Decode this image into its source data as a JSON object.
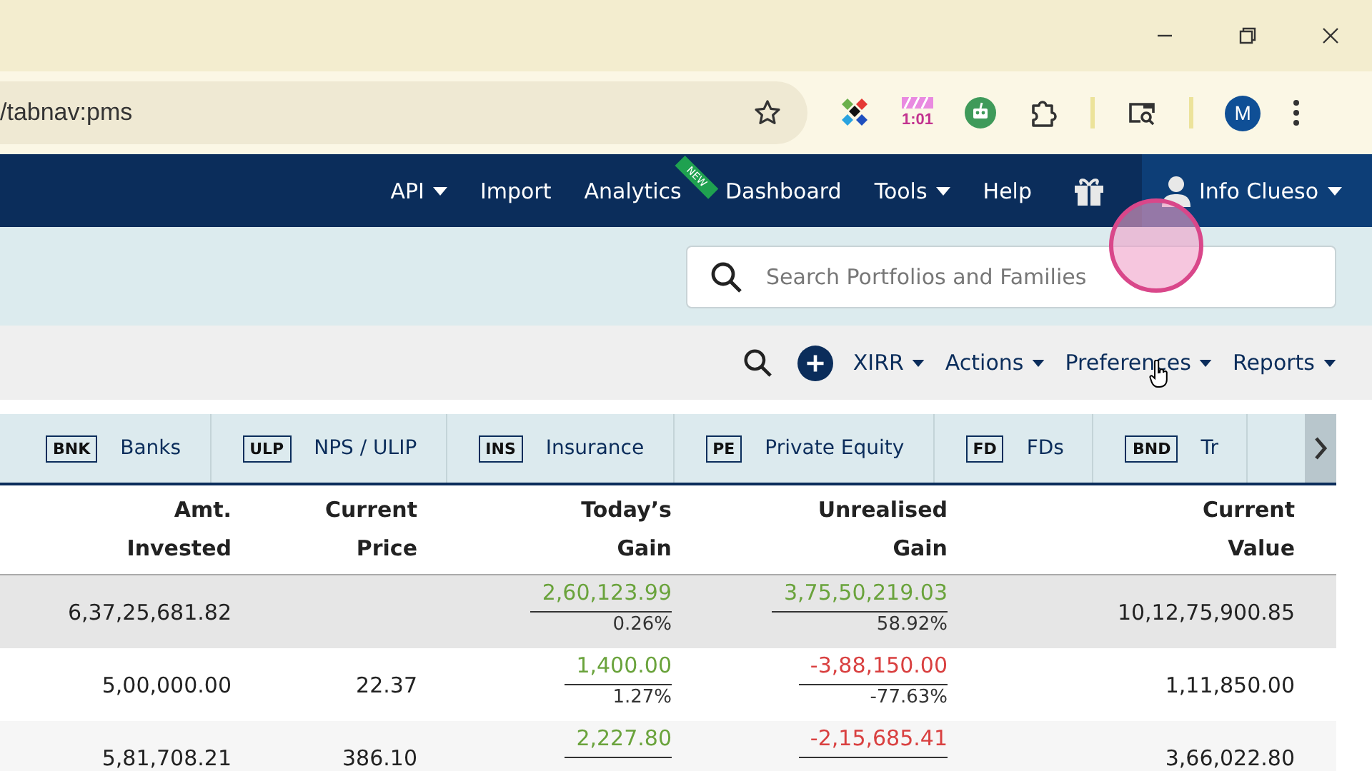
{
  "browser": {
    "address": "/tabnav:pms",
    "extension_badge": "1:01",
    "profile_initial": "M"
  },
  "nav": {
    "items": [
      {
        "label": "API",
        "dropdown": true
      },
      {
        "label": "Import",
        "dropdown": false
      },
      {
        "label": "Analytics",
        "dropdown": false,
        "badge": "NEW"
      },
      {
        "label": "Dashboard",
        "dropdown": false
      },
      {
        "label": "Tools",
        "dropdown": true
      },
      {
        "label": "Help",
        "dropdown": false
      }
    ],
    "user": {
      "label": "Info Clueso",
      "dropdown": true
    }
  },
  "search": {
    "placeholder": "Search Portfolios and Families"
  },
  "toolbar": {
    "menus": [
      "XIRR",
      "Actions",
      "Preferences",
      "Reports"
    ]
  },
  "asset_tabs": [
    {
      "code": "BNK",
      "label": "Banks"
    },
    {
      "code": "ULP",
      "label": "NPS / ULIP"
    },
    {
      "code": "INS",
      "label": "Insurance"
    },
    {
      "code": "PE",
      "label": "Private Equity"
    },
    {
      "code": "FD",
      "label": "FDs"
    },
    {
      "code": "BND",
      "label": "Tr"
    }
  ],
  "table": {
    "columns": [
      [
        "Amt.",
        "Invested"
      ],
      [
        "Current",
        "Price"
      ],
      [
        "Today’s",
        "Gain"
      ],
      [
        "Unrealised",
        "Gain"
      ],
      [
        "Current",
        "Value"
      ]
    ],
    "rows": [
      {
        "kind": "total",
        "invested": "6,37,25,681.82",
        "price": "",
        "today": {
          "value": "2,60,123.99",
          "percent": "0.26%",
          "color": "#6aa33c"
        },
        "unrealised": {
          "value": "3,75,50,219.03",
          "percent": "58.92%",
          "color": "#6aa33c"
        },
        "current_value": "10,12,75,900.85"
      },
      {
        "kind": "holding",
        "invested": "5,00,000.00",
        "price": "22.37",
        "today": {
          "value": "1,400.00",
          "percent": "1.27%",
          "color": "#6aa33c"
        },
        "unrealised": {
          "value": "-3,88,150.00",
          "percent": "-77.63%",
          "color": "#d94040"
        },
        "current_value": "1,11,850.00"
      },
      {
        "kind": "holding",
        "invested": "5,81,708.21",
        "price": "386.10",
        "today": {
          "value": "2,227.80",
          "color": "#6aa33c"
        },
        "unrealised": {
          "value": "-2,15,685.41",
          "color": "#d94040"
        },
        "current_value": "3,66,022.80"
      }
    ]
  }
}
